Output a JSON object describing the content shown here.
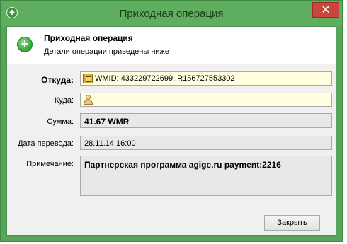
{
  "window": {
    "title": "Приходная операция",
    "close_glyph": "✕",
    "icon": "plus-icon",
    "accent_color": "#58a45a"
  },
  "header": {
    "title": "Приходная операция",
    "subtitle": "Детали операции приведены ниже",
    "icon": "plus-circle-icon"
  },
  "form": {
    "from": {
      "label": "Откуда:",
      "value": "WMID: 433229722699, R156727553302",
      "icon": "wallet-icon"
    },
    "to": {
      "label": "Куда:",
      "value": "",
      "icon": "person-icon"
    },
    "amount": {
      "label": "Сумма:",
      "value": "41.67 WMR"
    },
    "date": {
      "label": "Дата перевода:",
      "value": "28.11.14 16:00"
    },
    "note": {
      "label": "Примечание:",
      "value": "Партнерская программа agige.ru payment:2216"
    }
  },
  "footer": {
    "close_label": "Закрыть"
  }
}
